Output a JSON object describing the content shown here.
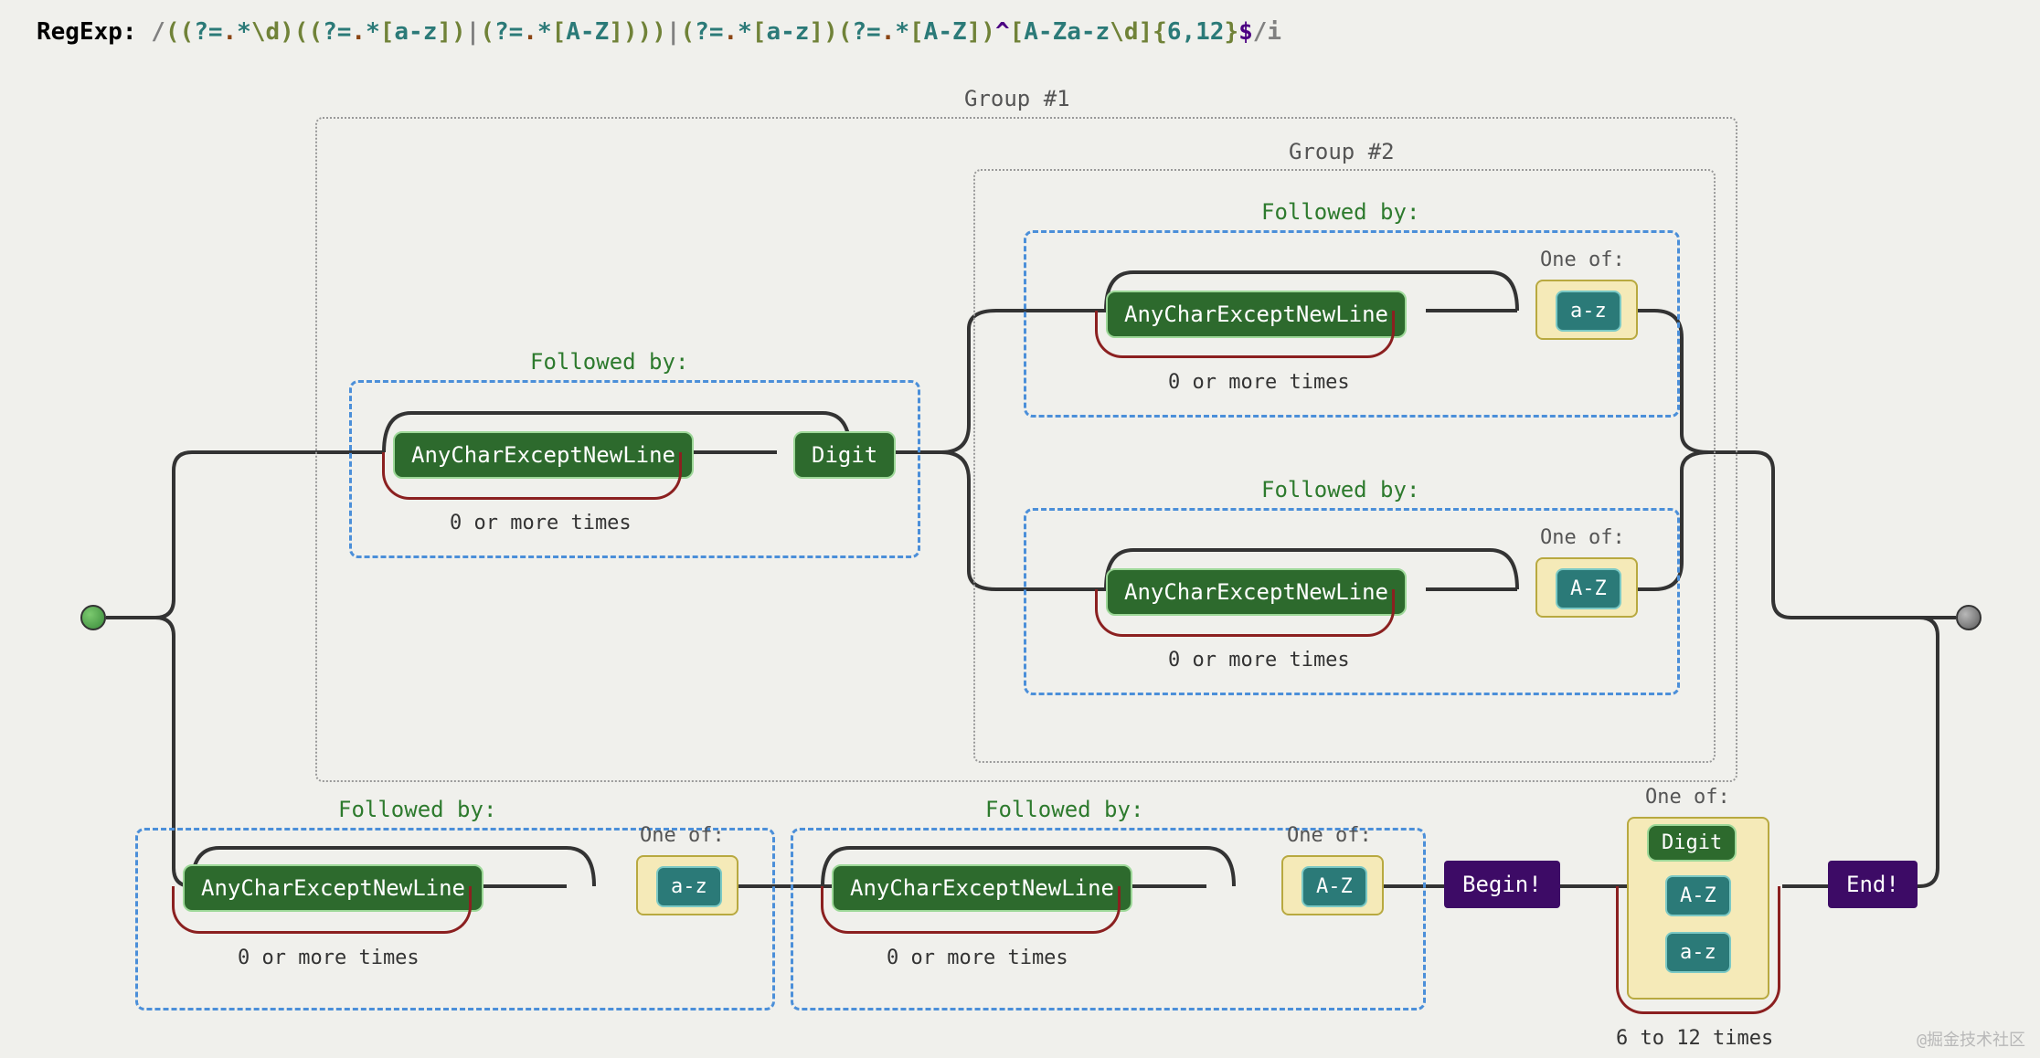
{
  "header": {
    "label": "RegExp:",
    "regex_display": "/((?=.*\\d)((?=.*[a-z])|(?=.*[A-Z])))|(?=.*[a-z])(?=.*[A-Z])^[A-Za-z\\d]{6,12}$/i"
  },
  "groups": {
    "g1": "Group #1",
    "g2": "Group #2"
  },
  "labels": {
    "followed_by": "Followed by:",
    "one_of": "One of:",
    "zero_or_more": "0 or more times",
    "six_to_twelve": "6 to 12 times"
  },
  "tokens": {
    "any_char": "AnyCharExceptNewLine",
    "digit": "Digit",
    "az_lower": "a-z",
    "az_upper": "A-Z",
    "begin": "Begin!",
    "end": "End!"
  },
  "watermark": "@掘金技术社区"
}
